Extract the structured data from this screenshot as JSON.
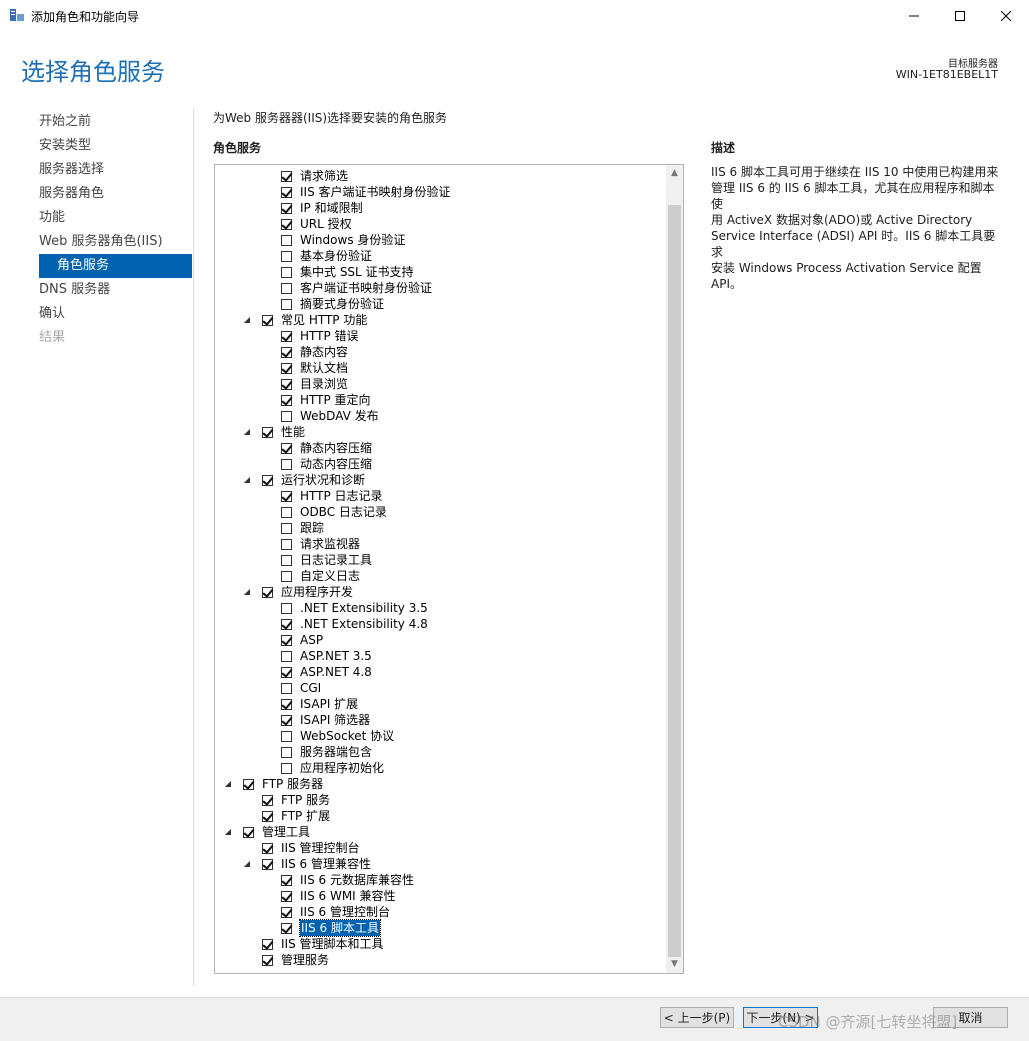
{
  "window": {
    "title": "添加角色和功能向导"
  },
  "header": {
    "title": "选择角色服务",
    "target_label": "目标服务器",
    "target_value": "WIN-1ET81EBEL1T"
  },
  "nav": {
    "items": [
      {
        "label": "开始之前",
        "state": "normal"
      },
      {
        "label": "安装类型",
        "state": "normal"
      },
      {
        "label": "服务器选择",
        "state": "normal"
      },
      {
        "label": "服务器角色",
        "state": "normal"
      },
      {
        "label": "功能",
        "state": "normal"
      },
      {
        "label": "Web 服务器角色(IIS)",
        "state": "normal"
      },
      {
        "label": "角色服务",
        "state": "active"
      },
      {
        "label": "DNS 服务器",
        "state": "normal"
      },
      {
        "label": "确认",
        "state": "normal"
      },
      {
        "label": "结果",
        "state": "disabled"
      }
    ]
  },
  "content": {
    "intro": "为Web 服务器器(IIS)选择要安装的角色服务",
    "roles_heading": "角色服务",
    "tree": [
      {
        "label": "请求筛选",
        "level": 3,
        "checked": true
      },
      {
        "label": "IIS 客户端证书映射身份验证",
        "level": 3,
        "checked": true
      },
      {
        "label": "IP 和域限制",
        "level": 3,
        "checked": true
      },
      {
        "label": "URL 授权",
        "level": 3,
        "checked": true
      },
      {
        "label": "Windows 身份验证",
        "level": 3,
        "checked": false
      },
      {
        "label": "基本身份验证",
        "level": 3,
        "checked": false
      },
      {
        "label": "集中式 SSL 证书支持",
        "level": 3,
        "checked": false
      },
      {
        "label": "客户端证书映射身份验证",
        "level": 3,
        "checked": false
      },
      {
        "label": "摘要式身份验证",
        "level": 3,
        "checked": false
      },
      {
        "label": "常见 HTTP 功能",
        "level": 2,
        "checked": true,
        "expander": true
      },
      {
        "label": "HTTP 错误",
        "level": 3,
        "checked": true
      },
      {
        "label": "静态内容",
        "level": 3,
        "checked": true
      },
      {
        "label": "默认文档",
        "level": 3,
        "checked": true
      },
      {
        "label": "目录浏览",
        "level": 3,
        "checked": true
      },
      {
        "label": "HTTP 重定向",
        "level": 3,
        "checked": true
      },
      {
        "label": "WebDAV 发布",
        "level": 3,
        "checked": false
      },
      {
        "label": "性能",
        "level": 2,
        "checked": true,
        "expander": true
      },
      {
        "label": "静态内容压缩",
        "level": 3,
        "checked": true
      },
      {
        "label": "动态内容压缩",
        "level": 3,
        "checked": false
      },
      {
        "label": "运行状况和诊断",
        "level": 2,
        "checked": true,
        "expander": true
      },
      {
        "label": "HTTP 日志记录",
        "level": 3,
        "checked": true
      },
      {
        "label": "ODBC 日志记录",
        "level": 3,
        "checked": false
      },
      {
        "label": "跟踪",
        "level": 3,
        "checked": false
      },
      {
        "label": "请求监视器",
        "level": 3,
        "checked": false
      },
      {
        "label": "日志记录工具",
        "level": 3,
        "checked": false
      },
      {
        "label": "自定义日志",
        "level": 3,
        "checked": false
      },
      {
        "label": "应用程序开发",
        "level": 2,
        "checked": true,
        "expander": true
      },
      {
        "label": ".NET Extensibility 3.5",
        "level": 3,
        "checked": false
      },
      {
        "label": ".NET Extensibility 4.8",
        "level": 3,
        "checked": true
      },
      {
        "label": "ASP",
        "level": 3,
        "checked": true
      },
      {
        "label": "ASP.NET 3.5",
        "level": 3,
        "checked": false
      },
      {
        "label": "ASP.NET 4.8",
        "level": 3,
        "checked": true
      },
      {
        "label": "CGI",
        "level": 3,
        "checked": false
      },
      {
        "label": "ISAPI 扩展",
        "level": 3,
        "checked": true
      },
      {
        "label": "ISAPI 筛选器",
        "level": 3,
        "checked": true
      },
      {
        "label": "WebSocket 协议",
        "level": 3,
        "checked": false
      },
      {
        "label": "服务器端包含",
        "level": 3,
        "checked": false
      },
      {
        "label": "应用程序初始化",
        "level": 3,
        "checked": false
      },
      {
        "label": "FTP 服务器",
        "level": 1,
        "checked": true,
        "expander": true
      },
      {
        "label": "FTP 服务",
        "level": 2,
        "checked": true
      },
      {
        "label": "FTP 扩展",
        "level": 2,
        "checked": true
      },
      {
        "label": "管理工具",
        "level": 1,
        "checked": true,
        "expander": true
      },
      {
        "label": "IIS 管理控制台",
        "level": 2,
        "checked": true
      },
      {
        "label": "IIS 6 管理兼容性",
        "level": 2,
        "checked": true,
        "expander": true
      },
      {
        "label": "IIS 6 元数据库兼容性",
        "level": 3,
        "checked": true
      },
      {
        "label": "IIS 6 WMI 兼容性",
        "level": 3,
        "checked": true
      },
      {
        "label": "IIS 6 管理控制台",
        "level": 3,
        "checked": true
      },
      {
        "label": "IIS 6 脚本工具",
        "level": 3,
        "checked": true,
        "selected": true
      },
      {
        "label": "IIS 管理脚本和工具",
        "level": 2,
        "checked": true
      },
      {
        "label": "管理服务",
        "level": 2,
        "checked": true
      }
    ]
  },
  "description": {
    "heading": "描述",
    "lines": [
      "IIS 6 脚本工具可用于继续在 IIS 10 中使用已构建用来",
      "管理 IIS 6 的 IIS 6 脚本工具，尤其在应用程序和脚本使",
      "用 ActiveX 数据对象(ADO)或 Active Directory",
      "Service Interface (ADSI) API 时。IIS 6 脚本工具要求",
      "安装 Windows Process Activation Service 配置",
      "API。"
    ]
  },
  "footer": {
    "prev_label": "< 上一步(P)",
    "next_label": "下一步(N) >",
    "cancel_label": "取消",
    "watermark": "CSDN @齐源[七转坐将盟]"
  },
  "colors": {
    "accent": "#0063b1",
    "title": "#1f6fb4",
    "footer_bg": "#f0f0f0"
  }
}
